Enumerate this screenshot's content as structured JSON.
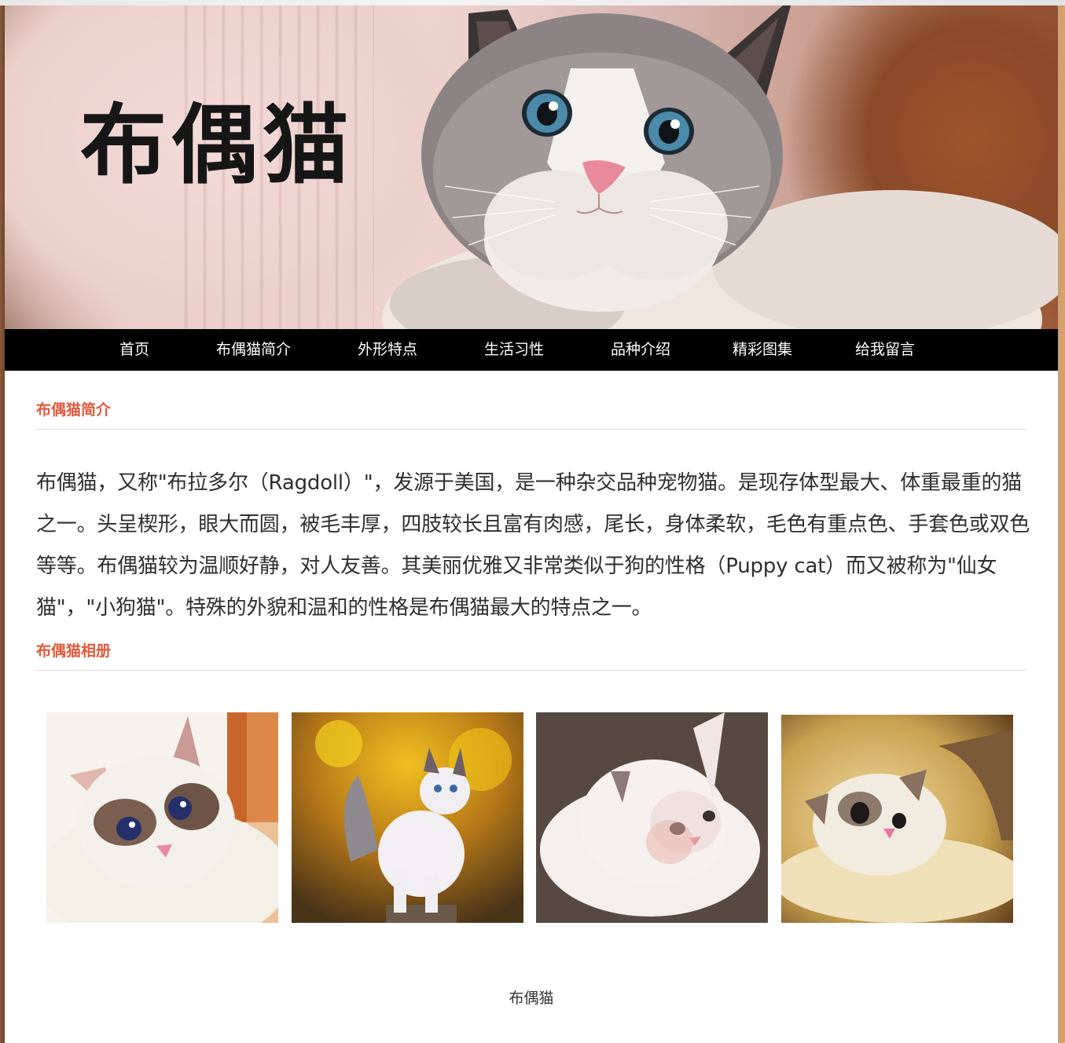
{
  "banner": {
    "title": "布偶猫"
  },
  "nav": {
    "items": [
      {
        "label": "首页"
      },
      {
        "label": "布偶猫简介"
      },
      {
        "label": "外形特点"
      },
      {
        "label": "生活习性"
      },
      {
        "label": "品种介绍"
      },
      {
        "label": "精彩图集"
      },
      {
        "label": "给我留言"
      }
    ]
  },
  "intro": {
    "heading": "布偶猫简介",
    "text": "布偶猫，又称\"布拉多尔（Ragdoll）\"，发源于美国，是一种杂交品种宠物猫。是现存体型最大、体重最重的猫之一。头呈楔形，眼大而圆，被毛丰厚，四肢较长且富有肉感，尾长，身体柔软，毛色有重点色、手套色或双色等等。布偶猫较为温顺好静，对人友善。其美丽优雅又非常类似于狗的性格（Puppy cat）而又被称为\"仙女猫\"，\"小狗猫\"。特殊的外貌和温和的性格是布偶猫最大的特点之一。"
  },
  "album": {
    "heading": "布偶猫相册",
    "photos": [
      {
        "name": "ragdoll-photo-1"
      },
      {
        "name": "ragdoll-photo-2"
      },
      {
        "name": "ragdoll-photo-3"
      },
      {
        "name": "ragdoll-photo-4"
      }
    ]
  },
  "footer": {
    "text": "布偶猫"
  },
  "colors": {
    "accent": "#e05a3c",
    "nav_bg": "#000000",
    "nav_text": "#ffffff",
    "body_text": "#2f2f2f"
  }
}
